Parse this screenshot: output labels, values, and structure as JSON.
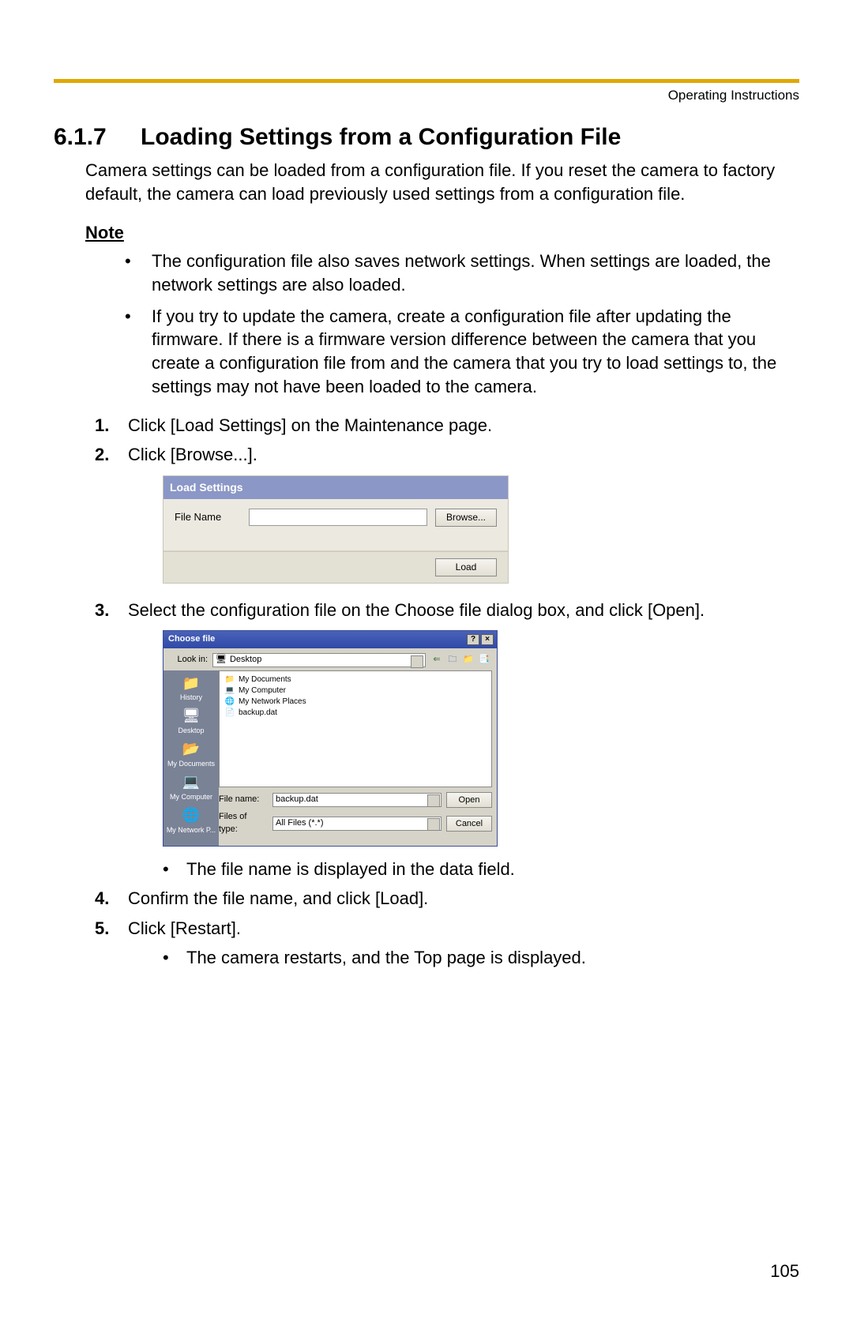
{
  "header": {
    "running_head": "Operating Instructions"
  },
  "section": {
    "number": "6.1.7",
    "title": "Loading Settings from a Configuration File"
  },
  "intro": "Camera settings can be loaded from a configuration file. If you reset the camera to factory default, the camera can load previously used settings from a configuration file.",
  "note_heading": "Note",
  "notes": [
    "The configuration file also saves network settings. When settings are loaded, the network settings are also loaded.",
    "If you try to update the camera, create a configuration file after updating the firmware. If there is a firmware version difference between the camera that you create a configuration file from and the camera that you try to load settings to, the settings may not have been loaded to the camera."
  ],
  "steps": {
    "s1": "Click [Load Settings] on the Maintenance page.",
    "s2": "Click [Browse...].",
    "s3": "Select the configuration file on the Choose file dialog box, and click [Open].",
    "s3_sub": "The file name is displayed in the data field.",
    "s4": "Confirm the file name, and click [Load].",
    "s5": "Click [Restart].",
    "s5_sub": "The camera restarts, and the Top page is displayed."
  },
  "load_panel": {
    "title": "Load Settings",
    "file_label": "File Name",
    "file_value": "",
    "browse": "Browse...",
    "load": "Load"
  },
  "choose_dialog": {
    "title": "Choose file",
    "help_btn": "?",
    "close_btn": "×",
    "look_in_label": "Look in:",
    "look_in_value": "Desktop",
    "nav": {
      "back": "⇐",
      "up": "🗀",
      "new": "📁",
      "view": "📑"
    },
    "sidebar": [
      {
        "icon": "📁",
        "label": "History"
      },
      {
        "icon": "🖥",
        "label": "Desktop"
      },
      {
        "icon": "📂",
        "label": "My Documents"
      },
      {
        "icon": "💻",
        "label": "My Computer"
      },
      {
        "icon": "🌐",
        "label": "My Network P..."
      }
    ],
    "files": [
      {
        "icon": "📁",
        "name": "My Documents"
      },
      {
        "icon": "💻",
        "name": "My Computer"
      },
      {
        "icon": "🌐",
        "name": "My Network Places"
      },
      {
        "icon": "📄",
        "name": "backup.dat"
      }
    ],
    "file_name_label": "File name:",
    "file_name_value": "backup.dat",
    "file_type_label": "Files of type:",
    "file_type_value": "All Files (*.*)",
    "open": "Open",
    "cancel": "Cancel"
  },
  "page_number": "105"
}
